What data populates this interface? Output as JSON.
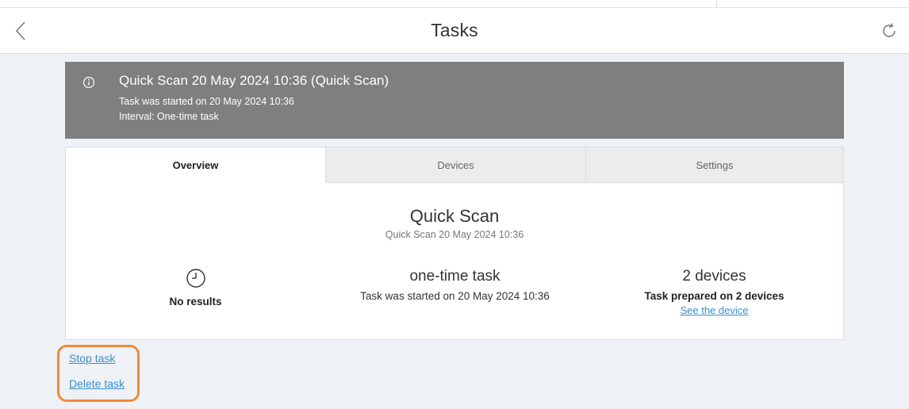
{
  "header": {
    "title": "Tasks"
  },
  "banner": {
    "title": "Quick Scan 20 May 2024 10:36 (Quick Scan)",
    "started": "Task was started on 20 May 2024 10:36",
    "interval": "Interval: One-time task"
  },
  "tabs": [
    {
      "label": "Overview",
      "active": true
    },
    {
      "label": "Devices",
      "active": false
    },
    {
      "label": "Settings",
      "active": false
    }
  ],
  "overview": {
    "task_name": "Quick Scan",
    "task_subtitle": "Quick Scan 20 May 2024 10:36",
    "results": {
      "icon": "clock-icon",
      "label": "No results"
    },
    "schedule": {
      "title": "one-time task",
      "detail": "Task was started on 20 May 2024 10:36"
    },
    "devices": {
      "title": "2 devices",
      "detail": "Task prepared on 2 devices",
      "link": "See the device"
    }
  },
  "actions": {
    "stop": "Stop task",
    "delete": "Delete task"
  },
  "colors": {
    "banner_bg": "#7f7f7f",
    "link": "#3a8fc7",
    "highlight": "#f08a3a"
  }
}
